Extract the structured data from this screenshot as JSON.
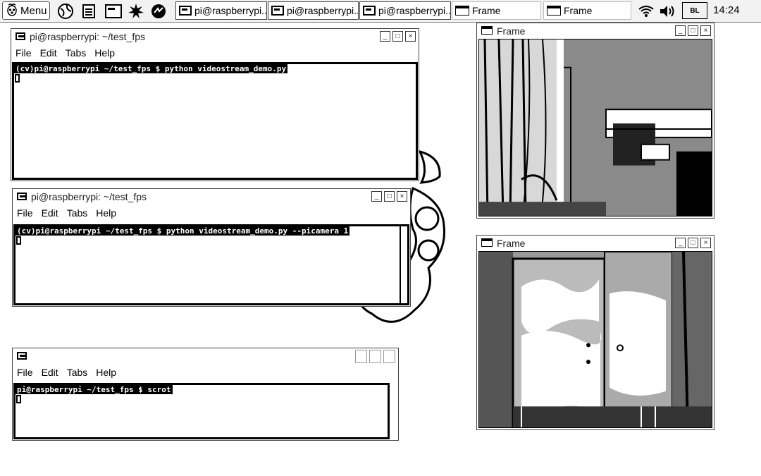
{
  "taskbar": {
    "menu_label": "Menu",
    "launchers": [
      "raspberry-logo-icon",
      "globe-icon",
      "file-manager-icon",
      "terminal-icon",
      "burst-icon",
      "wolfram-icon"
    ],
    "tasks": [
      {
        "label": "pi@raspberrypi..."
      },
      {
        "label": "pi@raspberrypi..."
      },
      {
        "label": "pi@raspberrypi..."
      },
      {
        "label": "Frame"
      },
      {
        "label": "Frame"
      }
    ],
    "clock": "14:24",
    "battery_label": "BL"
  },
  "windows": {
    "term1": {
      "title": "pi@raspberrypi: ~/test_fps",
      "menu": [
        "File",
        "Edit",
        "Tabs",
        "Help"
      ],
      "prompt": "(cv)pi@raspberrypi ~/test_fps $ python videostream_demo.py"
    },
    "term2": {
      "title": "pi@raspberrypi: ~/test_fps",
      "menu": [
        "File",
        "Edit",
        "Tabs",
        "Help"
      ],
      "prompt": "(cv)pi@raspberrypi ~/test_fps $ python videostream_demo.py --picamera 1"
    },
    "term3": {
      "menu": [
        "File",
        "Edit",
        "Tabs",
        "Help"
      ],
      "prompt": "pi@raspberrypi ~/test_fps $ scrot"
    },
    "frame1": {
      "title": "Frame"
    },
    "frame2": {
      "title": "Frame"
    }
  }
}
